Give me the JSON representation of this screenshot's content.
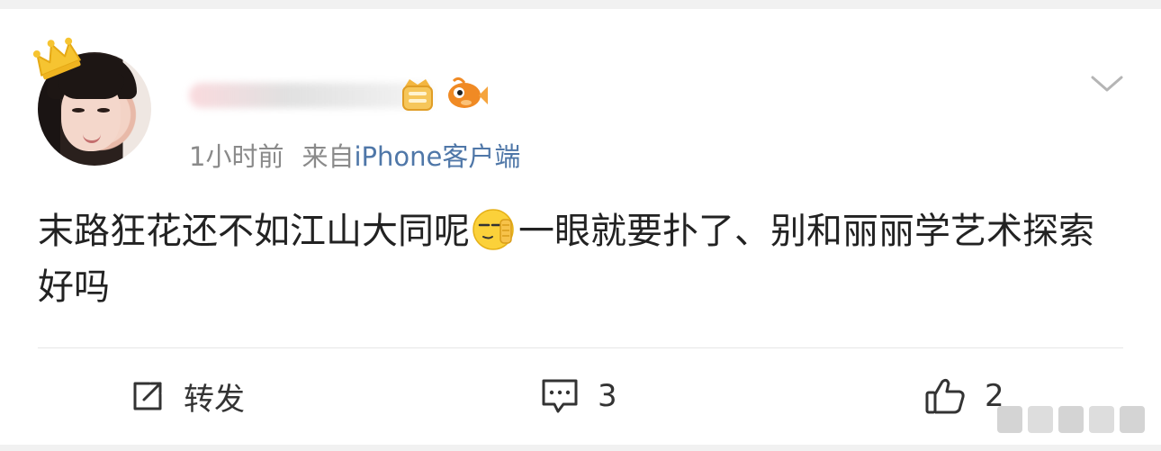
{
  "post": {
    "time": "1小时前",
    "source_prefix": "来自",
    "source_name": "iPhone客户端",
    "body_part1": "末路狂花还不如江山大同呢",
    "body_part2": "一眼就要扑了、别和丽丽学艺术探索好吗",
    "emoji": "face-with-hand-emoji"
  },
  "actions": {
    "repost_label": "转发",
    "comment_count": "3",
    "like_count": "2"
  },
  "icons": {
    "crown": "crown-icon",
    "vip_badge": "vip-badge-icon",
    "fish_badge": "fish-badge-icon",
    "more": "chevron-down-icon",
    "repost": "repost-icon",
    "comment": "comment-icon",
    "like": "thumbs-up-icon"
  },
  "colors": {
    "link": "#4f77a8",
    "meta": "#8a8a8a",
    "text": "#222222",
    "crown": "#f6c431",
    "badge_orange": "#f08a24"
  }
}
